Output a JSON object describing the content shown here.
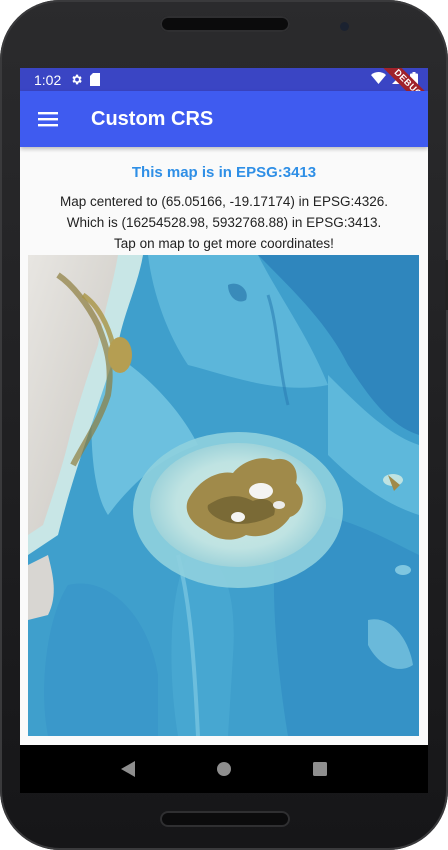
{
  "status_bar": {
    "time": "1:02",
    "icons": [
      "gear-icon",
      "sd-card-icon",
      "wifi-icon",
      "signal-icon",
      "battery-icon"
    ],
    "debug_banner": "DEBUG"
  },
  "app_bar": {
    "menu_icon": "hamburger-menu-icon",
    "title": "Custom CRS",
    "color": "#3f5bf0"
  },
  "content": {
    "heading": "This map is in EPSG:3413",
    "heading_color": "#2f8fe6",
    "line1": "Map centered to (65.05166, -19.17174) in EPSG:4326.",
    "line2": "Which is (16254528.98, 5932768.88) in EPSG:3413.",
    "line3": "Tap on map to get more coordinates!"
  },
  "map": {
    "description_icon": "bathymetry-map"
  },
  "nav_bar": {
    "back_icon": "back-triangle-icon",
    "home_icon": "home-circle-icon",
    "recents_icon": "recents-square-icon"
  }
}
